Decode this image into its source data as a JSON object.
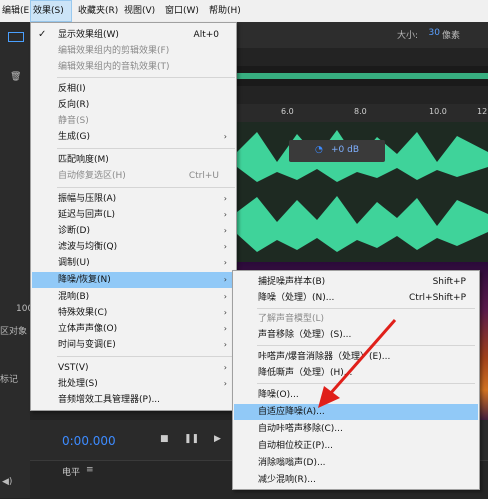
{
  "menubar": {
    "items": [
      "编辑(E)",
      "效果(S)",
      "收藏夹(R)",
      "视图(V)",
      "窗口(W)",
      "帮助(H)"
    ]
  },
  "toolbar": {
    "size_label": "大小:",
    "size_value": "30",
    "size_unit": "像素"
  },
  "timeline": {
    "ticks": [
      "6.0",
      "8.0",
      "10.0",
      "12.0"
    ],
    "volume_value": "+0 dB"
  },
  "transport": {
    "timecode": "0:00.000"
  },
  "left_panel": {
    "labels": [
      "区对象",
      "标记",
      "100"
    ]
  },
  "level": {
    "label": "电平"
  },
  "effects_menu": {
    "items": [
      {
        "label": "显示效果组(W)",
        "shortcut": "Alt+0",
        "checked": true
      },
      {
        "label": "编辑效果组内的剪辑效果(F)",
        "disabled": true
      },
      {
        "label": "编辑效果组内的音轨效果(T)",
        "disabled": true
      },
      {
        "label": "反相(I)"
      },
      {
        "label": "反向(R)"
      },
      {
        "label": "静音(S)",
        "disabled": true
      },
      {
        "label": "生成(G)",
        "submenu": true
      },
      {
        "label": "匹配响度(M)"
      },
      {
        "label": "自动修复选区(H)",
        "shortcut": "Ctrl+U",
        "disabled": true
      },
      {
        "label": "振幅与压限(A)",
        "submenu": true
      },
      {
        "label": "延迟与回声(L)",
        "submenu": true
      },
      {
        "label": "诊断(D)",
        "submenu": true
      },
      {
        "label": "滤波与均衡(Q)",
        "submenu": true
      },
      {
        "label": "调制(U)",
        "submenu": true
      },
      {
        "label": "降噪/恢复(N)",
        "submenu": true,
        "highlighted": true
      },
      {
        "label": "混响(B)",
        "submenu": true
      },
      {
        "label": "特殊效果(C)",
        "submenu": true
      },
      {
        "label": "立体声声像(O)",
        "submenu": true
      },
      {
        "label": "时间与变调(E)",
        "submenu": true
      },
      {
        "label": "VST(V)",
        "submenu": true
      },
      {
        "label": "批处理(S)",
        "submenu": true
      },
      {
        "label": "音频增效工具管理器(P)..."
      }
    ]
  },
  "noise_submenu": {
    "items": [
      {
        "label": "捕捉噪声样本(B)",
        "shortcut": "Shift+P"
      },
      {
        "label": "降噪（处理）(N)...",
        "shortcut": "Ctrl+Shift+P"
      },
      {
        "label": "了解声音模型(L)",
        "disabled": true
      },
      {
        "label": "声音移除（处理）(S)..."
      },
      {
        "label": "咔嗒声/爆音消除器（处理）(E)..."
      },
      {
        "label": "降低嘶声（处理）(H)..."
      },
      {
        "label": "降噪(O)..."
      },
      {
        "label": "自适应降噪(A)...",
        "highlighted": true
      },
      {
        "label": "自动咔嗒声移除(C)..."
      },
      {
        "label": "自动相位校正(P)..."
      },
      {
        "label": "消除嗡嗡声(D)..."
      },
      {
        "label": "减少混响(R)..."
      }
    ]
  }
}
